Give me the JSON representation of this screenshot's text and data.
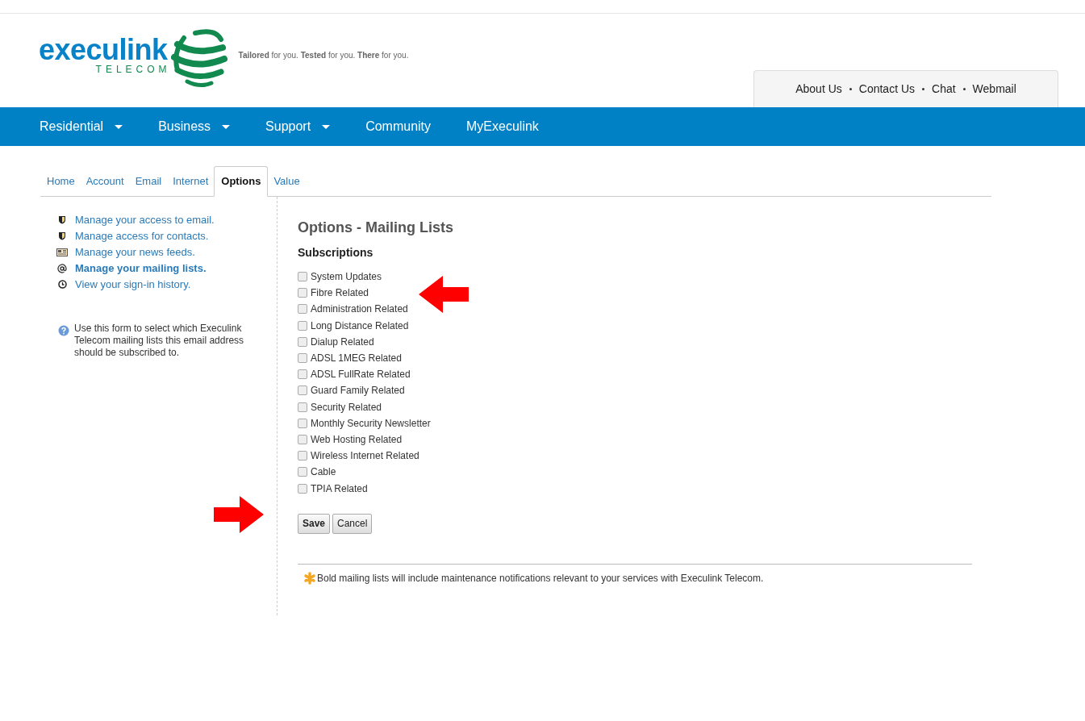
{
  "logo": {
    "name": "execulink",
    "subtitle": "TELECOM"
  },
  "tagline": "**Tailored** for you. **Tested** for you. **There** for you.",
  "top_links": [
    "About Us",
    "Contact Us",
    "Chat",
    "Webmail"
  ],
  "nav": [
    {
      "label": "Residential",
      "dropdown": true
    },
    {
      "label": "Business",
      "dropdown": true
    },
    {
      "label": "Support",
      "dropdown": true
    },
    {
      "label": "Community",
      "dropdown": false
    },
    {
      "label": "MyExeculink",
      "dropdown": false
    }
  ],
  "tabs": [
    {
      "label": "Home",
      "selected": false
    },
    {
      "label": "Account",
      "selected": false
    },
    {
      "label": "Email",
      "selected": false
    },
    {
      "label": "Internet",
      "selected": false
    },
    {
      "label": "Options",
      "selected": true
    },
    {
      "label": "Value",
      "selected": false
    }
  ],
  "sidebar": {
    "items": [
      {
        "kind": "shield",
        "label": "Manage your access to email.",
        "selected": false
      },
      {
        "kind": "shield",
        "label": "Manage access for contacts.",
        "selected": false
      },
      {
        "kind": "feed",
        "label": "Manage your news feeds.",
        "selected": false
      },
      {
        "kind": "at",
        "label": "Manage your mailing lists.",
        "selected": true
      },
      {
        "kind": "clock",
        "label": "View your sign-in history.",
        "selected": false
      }
    ],
    "help": "Use this form to select which Execulink Telecom mailing lists this email address should be subscribed to."
  },
  "content": {
    "title": "Options - Mailing Lists",
    "subtitle": "Subscriptions",
    "subscriptions": [
      {
        "label": "System Updates",
        "checked": false
      },
      {
        "label": "Fibre Related",
        "checked": false
      },
      {
        "label": "Administration Related",
        "checked": false
      },
      {
        "label": "Long Distance Related",
        "checked": false
      },
      {
        "label": "Dialup Related",
        "checked": false
      },
      {
        "label": "ADSL 1MEG Related",
        "checked": false
      },
      {
        "label": "ADSL FullRate Related",
        "checked": false
      },
      {
        "label": "Guard Family Related",
        "checked": false
      },
      {
        "label": "Security Related",
        "checked": false
      },
      {
        "label": "Monthly Security Newsletter",
        "checked": false
      },
      {
        "label": "Web Hosting Related",
        "checked": false
      },
      {
        "label": "Wireless Internet Related",
        "checked": false
      },
      {
        "label": "Cable",
        "checked": false
      },
      {
        "label": "TPIA Related",
        "checked": false
      }
    ],
    "buttons": [
      {
        "label": "Save",
        "kind": "primary"
      },
      {
        "label": "Cancel",
        "kind": "secondary"
      }
    ],
    "note": "Bold mailing lists will include maintenance notifications relevant to your services with Execulink Telecom."
  }
}
